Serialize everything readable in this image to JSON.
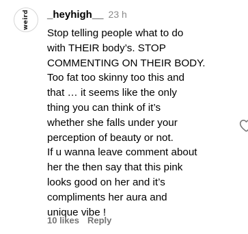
{
  "comment": {
    "avatar_text": "weird",
    "username": "_heyhigh__",
    "time": "23 h",
    "lines": [
      "Stop telling people what to do",
      "with THEIR body’s. STOP",
      "COMMENTING ON THEIR BODY.",
      "Too fat too skinny too this and",
      "that … it seems like the only",
      "thing you can think of it’s",
      "whether she falls under your",
      "perception of beauty or not.",
      "If u wanna leave comment about",
      "her the then say that this pink",
      "looks good on her and it’s",
      "compliments her aura and",
      "unique vibe !"
    ],
    "likes_label": "10 likes",
    "reply_label": "Reply",
    "like_icon": "heart-outline-icon"
  }
}
